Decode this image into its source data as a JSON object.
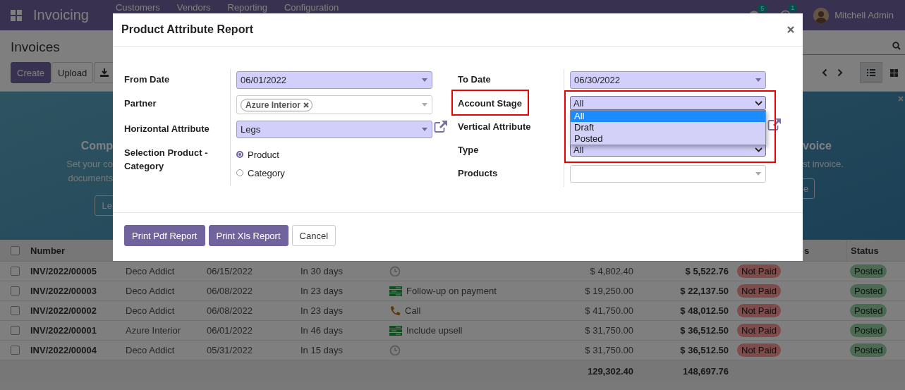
{
  "navbar": {
    "app": "Invoicing",
    "menu": [
      "Customers",
      "Vendors",
      "Reporting",
      "Configuration"
    ],
    "messages_badge": "5",
    "activities_badge": "1",
    "user": "Mitchell Admin"
  },
  "control_panel": {
    "title": "Invoices",
    "buttons": [
      {
        "label": "Create",
        "kind": "primary"
      },
      {
        "label": "Upload",
        "kind": "secondary"
      }
    ],
    "view_modes": [
      {
        "kind": "list",
        "selected": true
      },
      {
        "kind": "kanban",
        "selected": false
      }
    ]
  },
  "banner": {
    "left": {
      "title": "Comp",
      "lines": [
        "Set your co",
        "documents"
      ],
      "button": "Le"
    },
    "right": {
      "title": "voice",
      "lines": [
        "st invoice."
      ],
      "button": "e"
    }
  },
  "table": {
    "select_all_checked": false,
    "headers": {
      "number": "Number",
      "payment_status": "s",
      "status": "Status"
    },
    "rows": [
      {
        "checked": false,
        "number": "INV/2022/00005",
        "partner": "Deco Addict",
        "invoice_date": "06/15/2022",
        "due": "In 30 days",
        "activity": {
          "kind": "schedule"
        },
        "untaxed": "$ 4,802.40",
        "total": "$ 5,522.76",
        "payment_status": "Not Paid",
        "status": "Posted"
      },
      {
        "checked": false,
        "number": "INV/2022/00003",
        "partner": "Deco Addict",
        "invoice_date": "06/08/2022",
        "due": "In 23 days",
        "activity": {
          "kind": "todo",
          "label": "Follow-up on payment"
        },
        "untaxed": "$ 19,250.00",
        "total": "$ 22,137.50",
        "payment_status": "Not Paid",
        "status": "Posted"
      },
      {
        "checked": false,
        "number": "INV/2022/00002",
        "partner": "Deco Addict",
        "invoice_date": "06/08/2022",
        "due": "In 23 days",
        "activity": {
          "kind": "call",
          "label": "Call"
        },
        "untaxed": "$ 41,750.00",
        "total": "$ 48,012.50",
        "payment_status": "Not Paid",
        "status": "Posted"
      },
      {
        "checked": false,
        "number": "INV/2022/00001",
        "partner": "Azure Interior",
        "invoice_date": "06/01/2022",
        "due": "In 46 days",
        "activity": {
          "kind": "todo",
          "label": "Include upsell"
        },
        "untaxed": "$ 31,750.00",
        "total": "$ 36,512.50",
        "payment_status": "Not Paid",
        "status": "Posted"
      },
      {
        "checked": false,
        "number": "INV/2022/00004",
        "partner": "Deco Addict",
        "invoice_date": "05/31/2022",
        "due": "In 15 days",
        "activity": {
          "kind": "schedule"
        },
        "untaxed": "$ 31,750.00",
        "total": "$ 36,512.50",
        "payment_status": "Not Paid",
        "status": "Posted"
      }
    ],
    "totals": {
      "untaxed": "129,302.40",
      "total": "148,697.76"
    }
  },
  "dialog": {
    "title": "Product Attribute Report",
    "left_fields": [
      {
        "kind": "date",
        "label": "From Date",
        "value": "06/01/2022",
        "required": true
      },
      {
        "kind": "tags",
        "label": "Partner",
        "tags": [
          "Azure Interior"
        ],
        "required": false
      },
      {
        "kind": "many2one",
        "label": "Horizontal Attribute",
        "value": "Legs",
        "required": true,
        "external_link": true
      },
      {
        "kind": "radio",
        "label": "Selection Product - Category",
        "options": [
          {
            "label": "Product",
            "selected": true
          },
          {
            "label": "Category",
            "selected": false
          }
        ]
      }
    ],
    "right_fields": [
      {
        "kind": "date",
        "label": "To Date",
        "value": "06/30/2022",
        "required": true
      },
      {
        "kind": "select",
        "label": "Account Stage",
        "value": "All",
        "required": true,
        "annotated": true,
        "open": true,
        "options": [
          {
            "label": "All",
            "selected": true
          },
          {
            "label": "Draft",
            "selected": false
          },
          {
            "label": "Posted",
            "selected": false
          }
        ]
      },
      {
        "kind": "covered",
        "label": "Vertical Attribute",
        "external_link": true
      },
      {
        "kind": "select",
        "label": "Type",
        "value": "All",
        "required": true
      },
      {
        "kind": "many2one",
        "label": "Products",
        "required": false
      }
    ],
    "buttons": [
      {
        "label": "Print Pdf Report",
        "kind": "primary"
      },
      {
        "label": "Print Xls Report",
        "kind": "primary"
      },
      {
        "label": "Cancel",
        "kind": "secondary"
      }
    ]
  }
}
